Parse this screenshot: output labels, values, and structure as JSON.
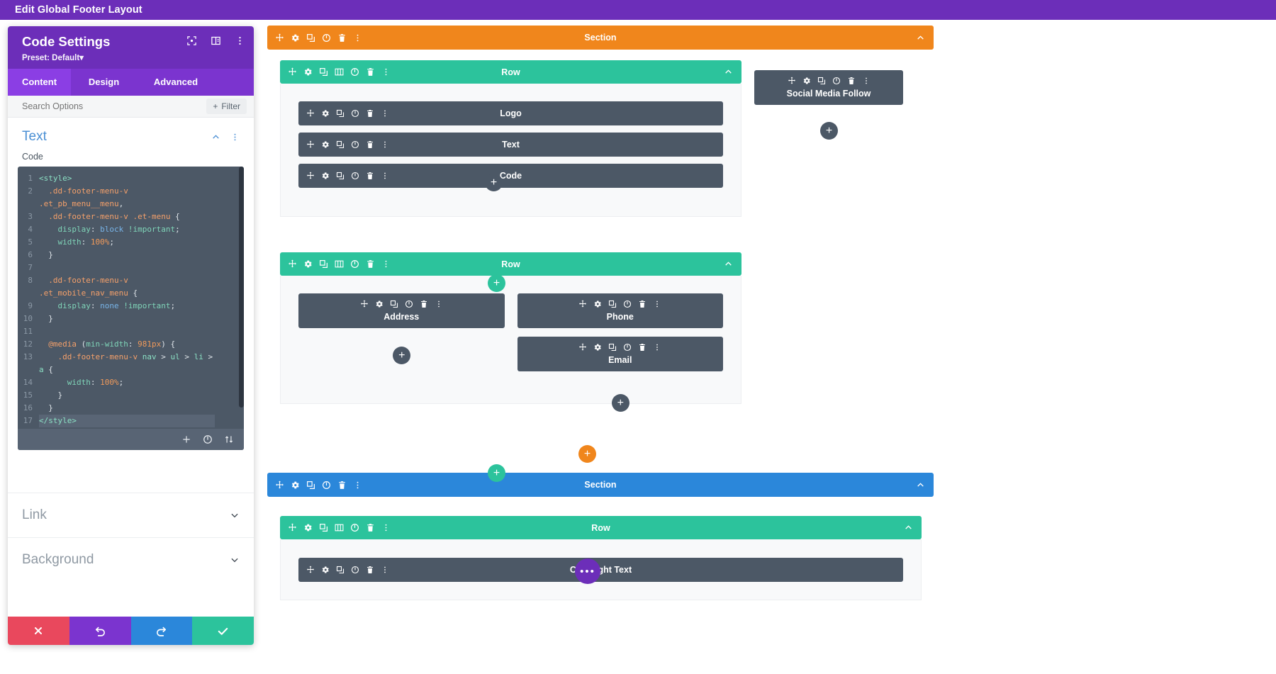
{
  "topbar": {
    "title": "Edit Global Footer Layout"
  },
  "modal": {
    "title": "Code Settings",
    "preset": "Preset: Default",
    "preset_caret": "▾",
    "header_icons": [
      {
        "name": "focus-target-icon"
      },
      {
        "name": "layout-panel-icon"
      },
      {
        "name": "kebab-menu-icon"
      }
    ],
    "tabs": [
      {
        "label": "Content",
        "active": true
      },
      {
        "label": "Design",
        "active": false
      },
      {
        "label": "Advanced",
        "active": false
      }
    ],
    "search": {
      "placeholder": "Search Options",
      "filter_label": "Filter",
      "filter_plus": "+"
    },
    "option_group": {
      "title": "Text",
      "collapse_icon": "chevron-up-icon",
      "menu_icon": "kebab-menu-icon"
    },
    "code_field": {
      "label": "Code",
      "lines": [
        {
          "n": "1",
          "html": "<span class='k-tag'>&lt;style&gt;</span>"
        },
        {
          "n": "2",
          "html": "  <span class='k-sel'>.dd-footer-menu-v</span>\n<span class='k-sel'>.et_pb_menu__menu</span><span class='k-punc'>,</span>"
        },
        {
          "n": "3",
          "html": "  <span class='k-sel'>.dd-footer-menu-v .et-menu</span> <span class='k-punc'>{</span>"
        },
        {
          "n": "4",
          "html": "    <span class='k-prop'>display</span><span class='k-punc'>:</span> <span class='k-val'>block</span> <span class='k-imp'>!important</span><span class='k-punc'>;</span>"
        },
        {
          "n": "5",
          "html": "    <span class='k-prop'>width</span><span class='k-punc'>:</span> <span class='k-num'>100%</span><span class='k-punc'>;</span>"
        },
        {
          "n": "6",
          "html": "  <span class='k-punc'>}</span>"
        },
        {
          "n": "7",
          "html": ""
        },
        {
          "n": "8",
          "html": "  <span class='k-sel'>.dd-footer-menu-v</span>\n<span class='k-sel'>.et_mobile_nav_menu</span> <span class='k-punc'>{</span>"
        },
        {
          "n": "9",
          "html": "    <span class='k-prop'>display</span><span class='k-punc'>:</span> <span class='k-val'>none</span> <span class='k-imp'>!important</span><span class='k-punc'>;</span>"
        },
        {
          "n": "10",
          "html": "  <span class='k-punc'>}</span>"
        },
        {
          "n": "11",
          "html": ""
        },
        {
          "n": "12",
          "html": "  <span class='k-at'>@media</span> <span class='k-punc'>(</span><span class='k-prop'>min-width</span><span class='k-punc'>:</span> <span class='k-num'>981px</span><span class='k-punc'>) {</span>"
        },
        {
          "n": "13",
          "html": "    <span class='k-sel'>.dd-footer-menu-v</span> <span class='k-el'>nav</span> <span class='k-op'>&gt;</span> <span class='k-el'>ul</span> <span class='k-op'>&gt;</span> <span class='k-el'>li</span> <span class='k-op'>&gt;</span>\n<span class='k-el'>a</span> <span class='k-punc'>{</span>"
        },
        {
          "n": "14",
          "html": "      <span class='k-prop'>width</span><span class='k-punc'>:</span> <span class='k-num'>100%</span><span class='k-punc'>;</span>"
        },
        {
          "n": "15",
          "html": "    <span class='k-punc'>}</span>"
        },
        {
          "n": "16",
          "html": "  <span class='k-punc'>}</span>"
        },
        {
          "n": "17",
          "html": "<span class='k-tag'>&lt;/style&gt;</span>",
          "highlight": true
        }
      ],
      "toolbar_icons": [
        {
          "name": "add-icon"
        },
        {
          "name": "power-toggle-icon"
        },
        {
          "name": "sort-updown-icon"
        }
      ]
    },
    "accordions": [
      {
        "label": "Link",
        "icon": "chevron-down-icon"
      },
      {
        "label": "Background",
        "icon": "chevron-down-icon"
      }
    ],
    "footer_buttons": [
      {
        "name": "cancel-button",
        "icon": "close-x-icon",
        "color": "#e9485d"
      },
      {
        "name": "undo-button",
        "icon": "undo-icon",
        "color": "#7b34cf"
      },
      {
        "name": "redo-button",
        "icon": "redo-icon",
        "color": "#2b87da"
      },
      {
        "name": "save-button",
        "icon": "check-icon",
        "color": "#2cc39c"
      }
    ]
  },
  "builder": {
    "section_one": {
      "label": "Section",
      "color": "#f0861c",
      "icons": [
        "move-icon",
        "gear-icon",
        "duplicate-icon",
        "power-toggle-icon",
        "trash-icon",
        "kebab-menu-icon"
      ],
      "collapse_icon": "chevron-up-icon"
    },
    "section_two": {
      "label": "Section",
      "color": "#2b87da",
      "icons": [
        "move-icon",
        "gear-icon",
        "duplicate-icon",
        "power-toggle-icon",
        "trash-icon",
        "kebab-menu-icon"
      ],
      "collapse_icon": "chevron-up-icon"
    },
    "row_icons": [
      "move-icon",
      "gear-icon",
      "duplicate-icon",
      "columns-icon",
      "power-toggle-icon",
      "trash-icon",
      "kebab-menu-icon"
    ],
    "module_icons": [
      "move-icon",
      "gear-icon",
      "duplicate-icon",
      "power-toggle-icon",
      "trash-icon",
      "kebab-menu-icon"
    ],
    "row_one": {
      "label": "Row",
      "modules": [
        {
          "label": "Logo"
        },
        {
          "label": "Text"
        },
        {
          "label": "Code"
        }
      ],
      "add_module_label": "+",
      "add_row_label": "+"
    },
    "row_two": {
      "label": "Row",
      "col_left": [
        {
          "label": "Address"
        }
      ],
      "col_right": [
        {
          "label": "Phone"
        },
        {
          "label": "Email"
        }
      ],
      "add_left_label": "+",
      "add_right_label": "+",
      "add_row_label": "+"
    },
    "social_module": {
      "label": "Social Media Follow",
      "add_label": "+"
    },
    "add_section_label": "+",
    "row_three": {
      "label": "Row",
      "dots_label": "•••",
      "modules": [
        {
          "label": "Copyright Text"
        }
      ]
    }
  }
}
